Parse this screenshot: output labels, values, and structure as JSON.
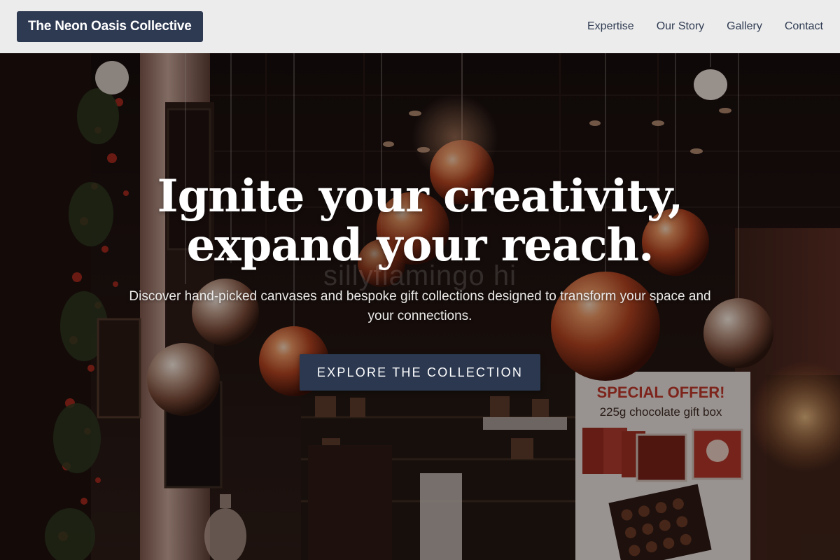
{
  "header": {
    "brand": "The Neon Oasis Collective",
    "nav": [
      {
        "label": "Expertise"
      },
      {
        "label": "Our Story"
      },
      {
        "label": "Gallery"
      },
      {
        "label": "Contact"
      }
    ]
  },
  "hero": {
    "headline_line1": "Ignite your creativity,",
    "headline_line2": "expand your reach.",
    "subtext": "Discover hand-picked canvases and bespoke gift collections designed to transform your space and your connections.",
    "cta_label": "EXPLORE THE COLLECTION",
    "watermark": "sillyflamingo hi",
    "background": {
      "description_icon": "christmas-shop-ornaments-image",
      "sign_line1": "SPECIAL OFFER!",
      "sign_line2": "225g chocolate gift box"
    }
  },
  "colors": {
    "header_bg": "#ececec",
    "brand_bg": "#2e3a52",
    "nav_text": "#2f3b52",
    "cta_bg": "#2b3850",
    "headline": "#ffffff",
    "sign_red": "#c4372a"
  }
}
